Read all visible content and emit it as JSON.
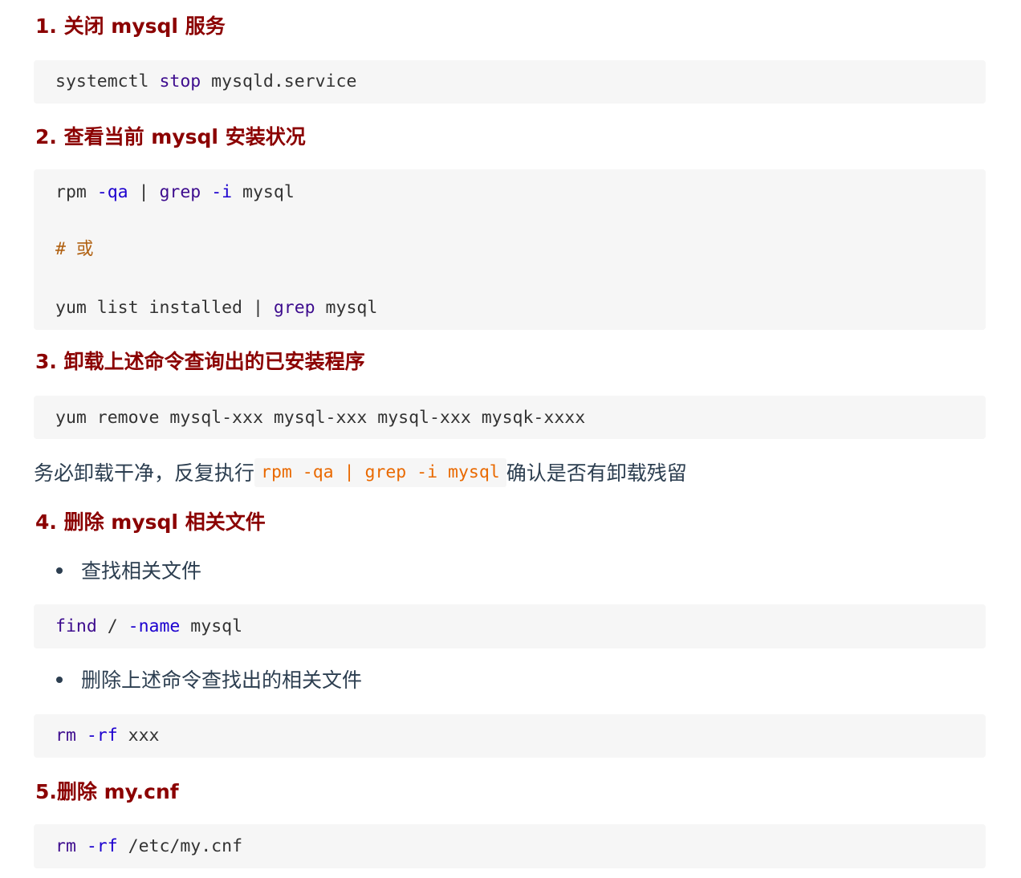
{
  "sections": [
    {
      "heading": "1. 关闭 mysql 服务",
      "code": [
        [
          "systemctl ",
          "stop",
          " mysqld.service"
        ]
      ]
    },
    {
      "heading": "2. 查看当前 mysql 安装状况",
      "code": [
        [
          "rpm ",
          "-qa",
          " | ",
          "grep",
          " ",
          "-i",
          " mysql"
        ],
        [
          "# 或"
        ],
        [
          "yum list installed | ",
          "grep",
          " mysql"
        ]
      ]
    },
    {
      "heading": "3. 卸载上述命令查询出的已安装程序",
      "code": [
        [
          "yum remove mysql-xxx mysql-xxx mysql-xxx mysqk-xxxx"
        ]
      ],
      "note_before": "务必卸载干净，反复执行",
      "note_code": "rpm -qa | grep -i mysql",
      "note_after": "确认是否有卸载残留"
    },
    {
      "heading": "4. 删除 mysql 相关文件",
      "bullet1": "查找相关文件",
      "code1": [
        "find",
        " / ",
        "-name",
        " mysql"
      ],
      "bullet2": "删除上述命令查找出的相关文件",
      "code2": [
        "rm",
        " ",
        "-rf",
        " xxx"
      ]
    },
    {
      "heading": "5.删除 my.cnf",
      "code": [
        [
          "rm",
          " ",
          "-rf",
          " /etc/my.cnf"
        ]
      ]
    }
  ],
  "colors": {
    "heading": "#8b0000",
    "keyword": "#1c00cf",
    "builtin": "#3d0c8e",
    "comment": "#b06010",
    "inline_code": "#e96900",
    "code_bg": "#f6f6f6",
    "text": "#2c3e50"
  }
}
